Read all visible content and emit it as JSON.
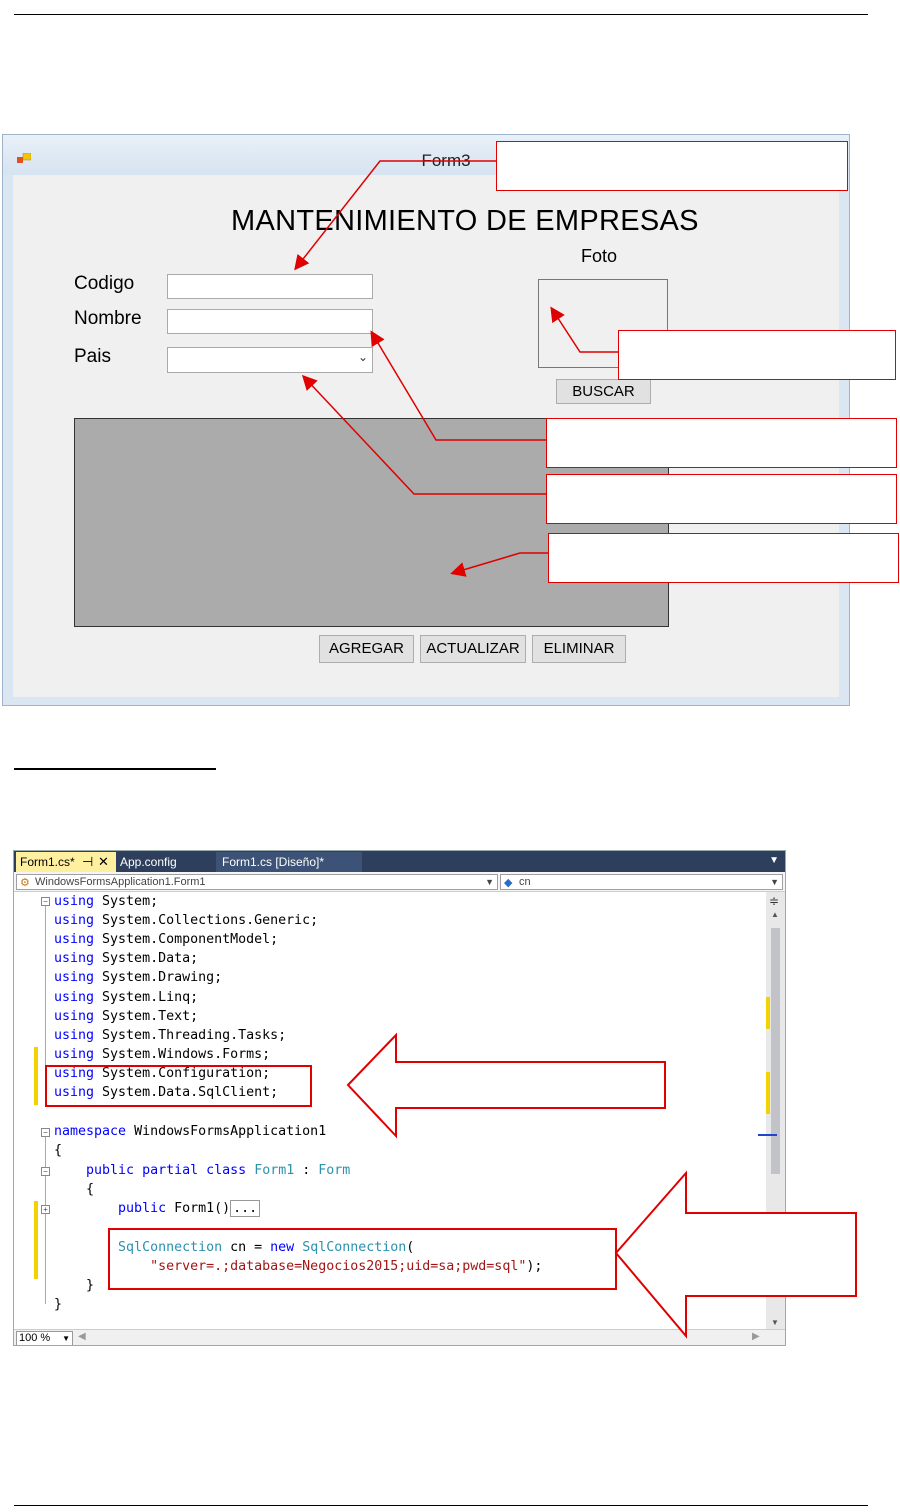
{
  "form_window": {
    "title": "Form3",
    "heading": "MANTENIMIENTO DE EMPRESAS",
    "labels": {
      "codigo": "Codigo",
      "nombre": "Nombre",
      "pais": "Pais",
      "foto": "Foto"
    },
    "buttons": {
      "buscar": "BUSCAR",
      "agregar": "AGREGAR",
      "actualizar": "ACTUALIZAR",
      "eliminar": "ELIMINAR"
    }
  },
  "editor": {
    "tabs": [
      {
        "label": "Form1.cs*",
        "pin": "⊣",
        "close": "✕"
      },
      {
        "label": "App.config"
      },
      {
        "label": "Form1.cs [Diseño]*"
      }
    ],
    "nav_left": "WindowsFormsApplication1.Form1",
    "nav_right": "cn",
    "zoom": "100 %",
    "code": {
      "l1_kw": "using",
      "l1_rest": " System;",
      "l2_kw": "using",
      "l2_rest": " System.Collections.Generic;",
      "l3_kw": "using",
      "l3_rest": " System.ComponentModel;",
      "l4_kw": "using",
      "l4_rest": " System.Data;",
      "l5_kw": "using",
      "l5_rest": " System.Drawing;",
      "l6_kw": "using",
      "l6_rest": " System.Linq;",
      "l7_kw": "using",
      "l7_rest": " System.Text;",
      "l8_kw": "using",
      "l8_rest": " System.Threading.Tasks;",
      "l9_kw": "using",
      "l9_rest": " System.Windows.Forms;",
      "l10_kw": "using",
      "l10_rest": " System.Configuration;",
      "l11_kw": "using",
      "l11_rest": " System.Data.SqlClient;",
      "ns_kw": "namespace",
      "ns_rest": " WindowsFormsApplication1",
      "brace_open": "{",
      "cls_kw1": "public",
      "cls_kw2": "partial",
      "cls_kw3": "class",
      "cls_name": "Form1",
      "cls_colon": " : ",
      "cls_base": "Form",
      "inner_open": "{",
      "ctor_kw": "public",
      "ctor_rest": " Form1()",
      "ctor_collapsed": "...",
      "sql_type": "SqlConnection",
      "sql_mid": " cn = ",
      "sql_new": "new",
      "sql_type2": "SqlConnection",
      "sql_paren": "(",
      "sql_str": "\"server=.;database=Negocios2015;uid=sa;pwd=sql\"",
      "sql_end": ");",
      "inner_close": "}",
      "brace_close": "}"
    }
  }
}
